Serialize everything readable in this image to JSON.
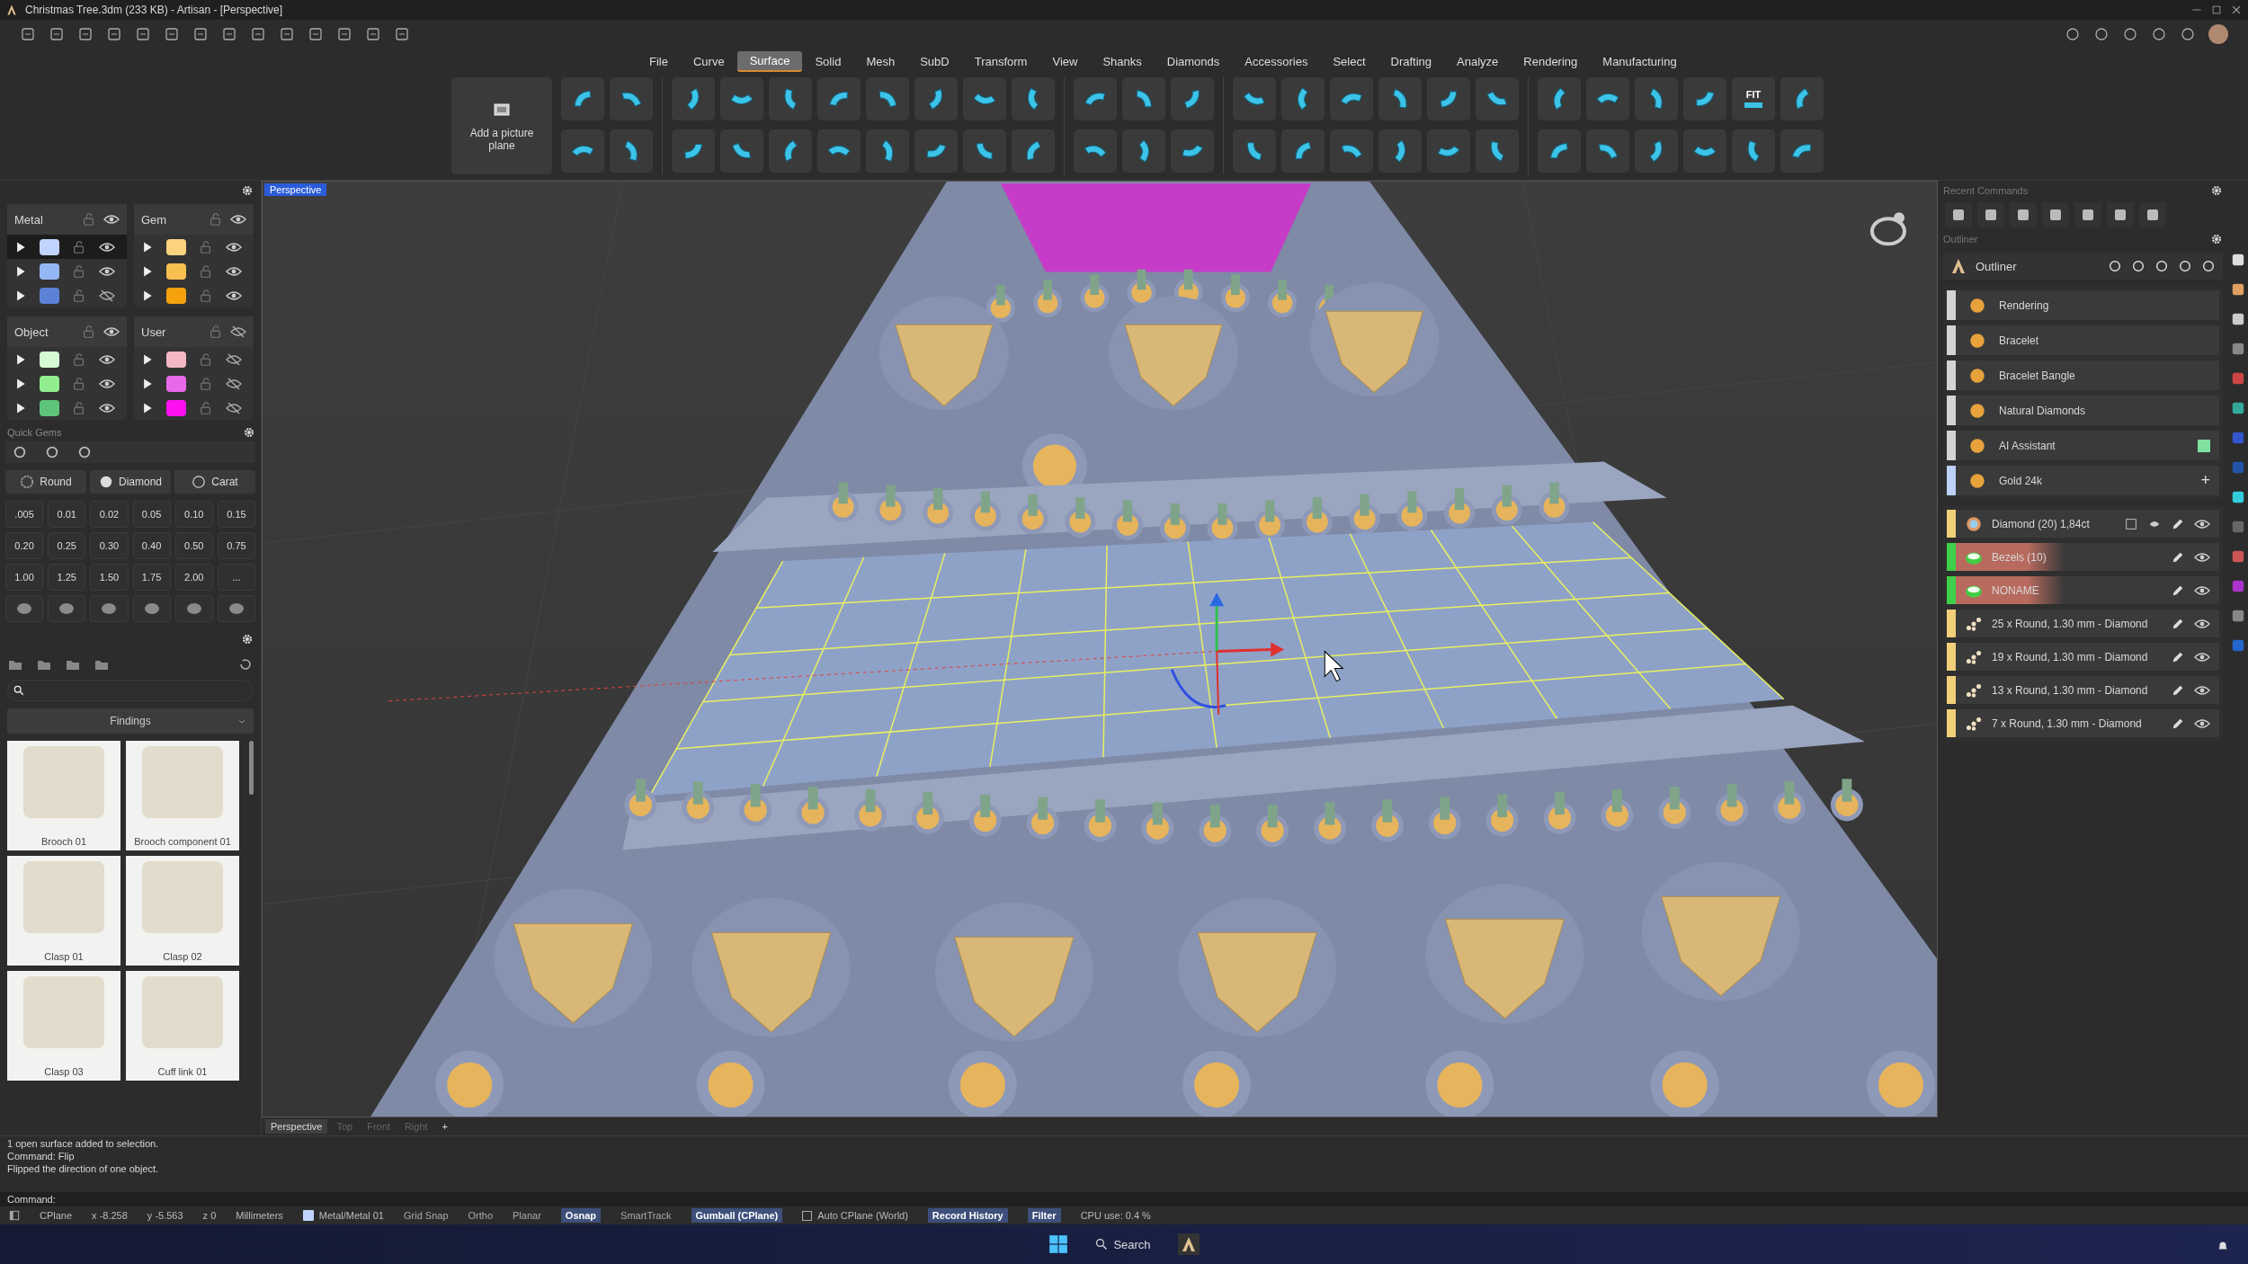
{
  "window": {
    "title": "Christmas Tree.3dm (233 KB) - Artisan - [Perspective]"
  },
  "menu": [
    {
      "label": "File",
      "selected": false
    },
    {
      "label": "Curve",
      "selected": false
    },
    {
      "label": "Surface",
      "selected": true
    },
    {
      "label": "Solid",
      "selected": false
    },
    {
      "label": "Mesh",
      "selected": false
    },
    {
      "label": "SubD",
      "selected": false
    },
    {
      "label": "Transform",
      "selected": false
    },
    {
      "label": "View",
      "selected": false
    },
    {
      "label": "Shanks",
      "selected": false
    },
    {
      "label": "Diamonds",
      "selected": false
    },
    {
      "label": "Accessories",
      "selected": false
    },
    {
      "label": "Select",
      "selected": false
    },
    {
      "label": "Drafting",
      "selected": false
    },
    {
      "label": "Analyze",
      "selected": false
    },
    {
      "label": "Rendering",
      "selected": false
    },
    {
      "label": "Manufacturing",
      "selected": false
    }
  ],
  "ribbon": {
    "picture_plane_button": "Add a picture plane",
    "fit_label": "FIT"
  },
  "layer_groups": [
    {
      "name": "Metal",
      "visible": true,
      "layers": [
        {
          "color": "#c0d4ff",
          "visible": true,
          "selected": true
        },
        {
          "color": "#94b8f5",
          "visible": true,
          "selected": false
        },
        {
          "color": "#5b82d6",
          "visible": false,
          "selected": false
        }
      ]
    },
    {
      "name": "Gem",
      "visible": true,
      "layers": [
        {
          "color": "#fbd37f",
          "visible": true,
          "selected": false
        },
        {
          "color": "#f8c050",
          "visible": true,
          "selected": false
        },
        {
          "color": "#f5a20e",
          "visible": true,
          "selected": false
        }
      ]
    },
    {
      "name": "Object",
      "visible": true,
      "layers": [
        {
          "color": "#d5fbd5",
          "visible": true,
          "selected": false
        },
        {
          "color": "#90ee90",
          "visible": true,
          "selected": false
        },
        {
          "color": "#5ec47a",
          "visible": true,
          "selected": false
        }
      ]
    },
    {
      "name": "User",
      "visible": false,
      "layers": [
        {
          "color": "#f4b8c4",
          "visible": false,
          "selected": false
        },
        {
          "color": "#e86ae8",
          "visible": false,
          "selected": false
        },
        {
          "color": "#ff10f0",
          "visible": false,
          "selected": false
        }
      ]
    }
  ],
  "quick_gems": {
    "title": "Quick Gems",
    "shape": "Round",
    "material": "Diamond",
    "unit": "Carat",
    "sizes": [
      ".005",
      "0.01",
      "0.02",
      "0.05",
      "0.10",
      "0.15",
      "0.20",
      "0.25",
      "0.30",
      "0.40",
      "0.50",
      "0.75",
      "1.00",
      "1.25",
      "1.50",
      "1.75",
      "2.00",
      "..."
    ]
  },
  "library": {
    "category": "Findings",
    "items": [
      {
        "caption": "Brooch 01"
      },
      {
        "caption": "Brooch component 01"
      },
      {
        "caption": "Clasp 01"
      },
      {
        "caption": "Clasp 02"
      },
      {
        "caption": "Clasp 03"
      },
      {
        "caption": "Cuff link 01"
      }
    ]
  },
  "viewport": {
    "label": "Perspective",
    "tabs": [
      {
        "label": "Perspective",
        "selected": true
      },
      {
        "label": "Top",
        "selected": false
      },
      {
        "label": "Front",
        "selected": false
      },
      {
        "label": "Right",
        "selected": false
      }
    ],
    "add_tab": "+"
  },
  "recent_commands": {
    "title": "Recent Commands"
  },
  "outliner": {
    "panel_title": "Outliner",
    "header": "Outliner",
    "plugins": [
      {
        "label": "Rendering",
        "color": "#d4d4d4",
        "indicator": false
      },
      {
        "label": "Bracelet",
        "color": "#d4d4d4",
        "indicator": false
      },
      {
        "label": "Bracelet Bangle",
        "color": "#d4d4d4",
        "indicator": false
      },
      {
        "label": "Natural Diamonds",
        "color": "#d4d4d4",
        "indicator": false
      },
      {
        "label": "AI Assistant",
        "color": "#d4d4d4",
        "indicator": true
      },
      {
        "label": "Gold 24k",
        "color": "#bcd0f8",
        "indicator": false,
        "action": "+"
      }
    ],
    "objects": [
      {
        "label": "Diamond (20) 1,84ct",
        "kind": "gem",
        "color": "#f2cf7a",
        "selected": false
      },
      {
        "label": "Bezels (10)",
        "kind": "bezel",
        "color": "#3fcf4a",
        "selected": true
      },
      {
        "label": "NONAME",
        "kind": "bezel",
        "color": "#3fcf4a",
        "selected": true
      },
      {
        "label": "25 x Round, 1.30 mm - Diamond",
        "kind": "stones",
        "color": "#f2cf7a",
        "selected": false
      },
      {
        "label": "19 x Round, 1.30 mm - Diamond",
        "kind": "stones",
        "color": "#f2cf7a",
        "selected": false
      },
      {
        "label": "13 x Round, 1.30 mm - Diamond",
        "kind": "stones",
        "color": "#f2cf7a",
        "selected": false
      },
      {
        "label": "7 x Round, 1.30 mm - Diamond",
        "kind": "stones",
        "color": "#f2cf7a",
        "selected": false
      }
    ]
  },
  "command": {
    "history": [
      "1 open surface added to selection.",
      "Command: Flip",
      "Flipped the direction of one object."
    ],
    "prompt": "Command:"
  },
  "status_bar": [
    {
      "kind": "text",
      "label": "CPlane"
    },
    {
      "kind": "text",
      "label": "x -8.258"
    },
    {
      "kind": "text",
      "label": "y -5.563"
    },
    {
      "kind": "text",
      "label": "z 0"
    },
    {
      "kind": "text",
      "label": "Millimeters"
    },
    {
      "kind": "swatch",
      "label": "Metal/Metal 01",
      "color": "#c0d4ff"
    },
    {
      "kind": "toggle",
      "label": "Grid Snap",
      "on": false
    },
    {
      "kind": "toggle",
      "label": "Ortho",
      "on": false
    },
    {
      "kind": "toggle",
      "label": "Planar",
      "on": false
    },
    {
      "kind": "toggle",
      "label": "Osnap",
      "on": true
    },
    {
      "kind": "toggle",
      "label": "SmartTrack",
      "on": false
    },
    {
      "kind": "toggle",
      "label": "Gumball (CPlane)",
      "on": true
    },
    {
      "kind": "checkbox",
      "label": "Auto CPlane (World)",
      "checked": false
    },
    {
      "kind": "toggle",
      "label": "Record History",
      "on": true
    },
    {
      "kind": "toggle",
      "label": "Filter",
      "on": true
    },
    {
      "kind": "text",
      "label": "CPU use: 0.4 %"
    }
  ],
  "taskbar": {
    "search": "Search"
  }
}
